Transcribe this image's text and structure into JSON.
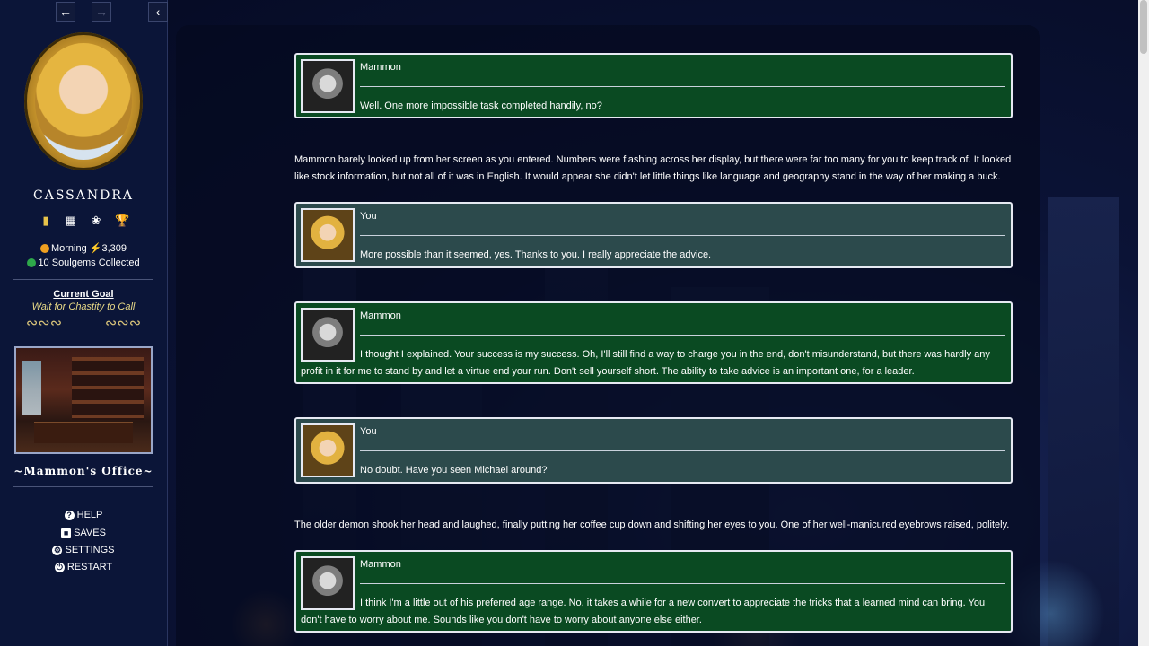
{
  "sidebar": {
    "back_icon": "arrow-left-icon",
    "forward_icon": "arrow-right-icon",
    "collapse_icon": "chevron-left-icon",
    "character_name": "CASSANDRA",
    "icons": [
      "tablet-icon",
      "id-card-icon",
      "palette-icon",
      "trophy-icon"
    ],
    "time_of_day": "Morning",
    "energy": "3,309",
    "soulgems": "10 Soulgems Collected",
    "goal_title": "Current Goal",
    "goal_text": "Wait for Chastity to Call",
    "location": "~Mammon's Office~",
    "menu": {
      "help": "HELP",
      "saves": "SAVES",
      "settings": "SETTINGS",
      "restart": "RESTART"
    }
  },
  "dialogue": [
    {
      "speaker": "Mammon",
      "text": "Well. One more impossible task completed handily, no?"
    },
    {
      "narration": "Mammon barely looked up from her screen as you entered. Numbers were flashing across her display, but there were far too many for you to keep track of. It looked like stock information, but not all of it was in English. It would appear she didn't let little things like language and geography stand in the way of her making a buck."
    },
    {
      "speaker": "You",
      "text": "More possible than it seemed, yes. Thanks to you. I really appreciate the advice."
    },
    {
      "speaker": "Mammon",
      "text": "I thought I explained. Your success is my success. Oh, I'll still find a way to charge you in the end, don't misunderstand, but there was hardly any profit in it for me to stand by and let a virtue end your run. Don't sell yourself short. The ability to take advice is an important one, for a leader."
    },
    {
      "speaker": "You",
      "text": "No doubt. Have you seen Michael around?"
    },
    {
      "narration": "The older demon shook her head and laughed, finally putting her coffee cup down and shifting her eyes to you. One of her well-manicured eyebrows raised, politely."
    },
    {
      "speaker": "Mammon",
      "text": "I think I'm a little out of his preferred age range. No, it takes a while for a new convert to appreciate the tricks that a learned mind can bring. You don't have to worry about me. Sounds like you don't have to worry about anyone else either."
    }
  ],
  "colors": {
    "mammon_box": "#0a4a22",
    "you_box": "#2c4a4c",
    "goal_text": "#e8d987"
  }
}
